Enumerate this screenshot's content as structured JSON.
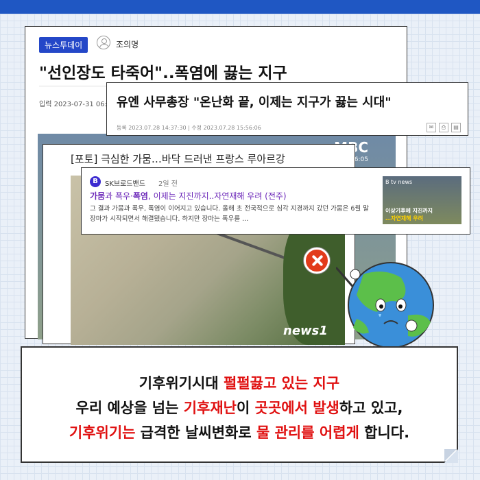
{
  "card1": {
    "badge": "뉴스투데이",
    "author": "조의명",
    "headline": "\"선인장도 타죽어\"..폭염에 끓는 지구",
    "date": "입력 2023-07-31 06:08",
    "logo": "MBC",
    "logo_sub": "11/월 06:05"
  },
  "card2": {
    "title": "유엔 사무총장 \"온난화 끝, 이제는 지구가 끓는 시대\"",
    "meta": "등록 2023.07.28 14:37:30  |  수정 2023.07.28 15:56:06",
    "icons": [
      "mail-icon",
      "print-icon",
      "pdf-icon"
    ]
  },
  "card3": {
    "title": "[포토] 극심한 가뭄…바닥 드러낸 프랑스 루아르강",
    "watermark": "news1"
  },
  "card4": {
    "logo_letter": "B",
    "source": "SK브로드밴드",
    "ago": "2일 전",
    "headline_a": "가뭄",
    "headline_b": "과 폭우·",
    "headline_c": "폭염",
    "headline_d": ", 이제는 지진까지..자연재해 우려 (전주)",
    "snippet": "그 결과 가뭄과 폭우, 폭염이 이어지고 있습니다. 올해 초 전국적으로 심각 지경까지 갔던 가뭄은 6월 말 장마가 시작되면서 해결됐습니다. 하지만 장마는 폭우를 ...",
    "thumb_tv": "B tv news",
    "thumb_cap1": "이상기후에 지진까지",
    "thumb_cap2": "…자연재해 우려"
  },
  "caption": {
    "l1_a": "기후위기시대 ",
    "l1_b": "펄펄끓고 있는 지구",
    "l2_a": "우리 예상을 넘는 ",
    "l2_b": "기후재난",
    "l2_c": "이 ",
    "l2_d": "곳곳에서 발생",
    "l2_e": "하고 있고,",
    "l3_a": "기후위기는",
    "l3_b": " 급격한 날씨변화로 ",
    "l3_c": "물 관리를 어렵게",
    "l3_d": " 합니다."
  },
  "colors": {
    "accent_blue": "#1f57c3",
    "highlight_red": "#e01010",
    "badge_blue": "#2447c8",
    "link_purple": "#6a25b8"
  }
}
